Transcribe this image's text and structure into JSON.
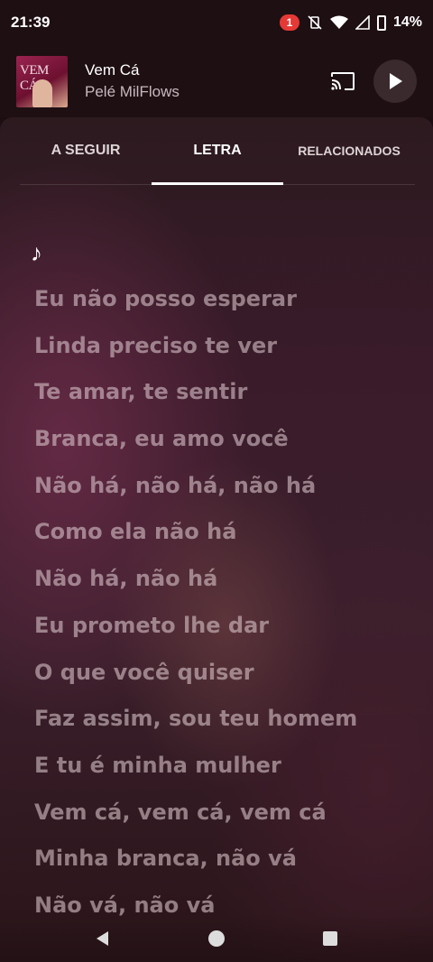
{
  "status_bar": {
    "time": "21:39",
    "notification_count": "1",
    "battery": "14%"
  },
  "mini_player": {
    "album_art_text": "VEM CÁ",
    "title": "Vem Cá",
    "artist": "Pelé MilFlows",
    "icons": [
      "cast-icon",
      "play-icon"
    ]
  },
  "tabs": [
    {
      "label": "A SEGUIR",
      "active": false
    },
    {
      "label": "LETRA",
      "active": true
    },
    {
      "label": "RELACIONADOS",
      "active": false
    }
  ],
  "lyrics": {
    "note_symbol": "♪",
    "lines": [
      "Eu não posso esperar",
      "Linda preciso te ver",
      "Te amar, te sentir",
      "Branca, eu amo você",
      "Não há, não há, não há",
      "Como ela não há",
      "Não há, não há",
      "Eu prometo lhe dar",
      "O que você quiser",
      "Faz assim, sou teu homem",
      "E tu é minha mulher",
      "Vem cá, vem cá, vem cá",
      "Minha branca, não vá",
      "Não vá, não vá"
    ]
  },
  "colors": {
    "background": "#1c0d12",
    "accent": "#ffffff",
    "notification": "#e53935",
    "lyric_inactive": "#d7c3c8"
  }
}
